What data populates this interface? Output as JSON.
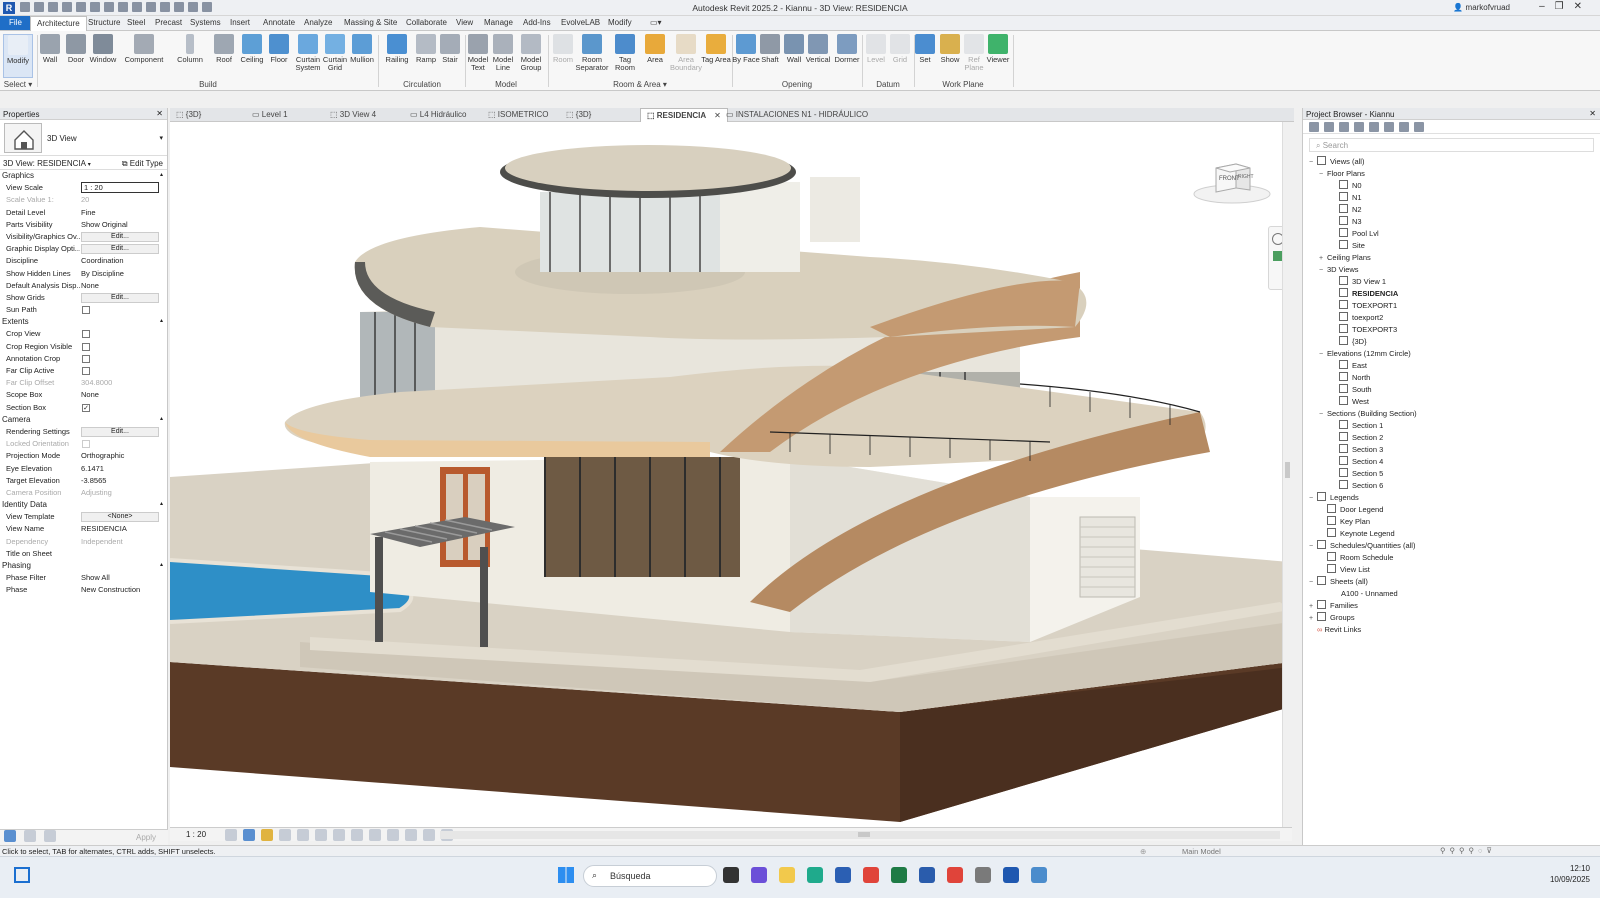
{
  "window": {
    "title": "Autodesk Revit 2025.2 - Kiannu - 3D View: RESIDENCIA",
    "user": "markofvruad"
  },
  "ribbon_tabs": [
    "File",
    "Architecture",
    "Structure",
    "Steel",
    "Precast",
    "Systems",
    "Insert",
    "Annotate",
    "Analyze",
    "Massing & Site",
    "Collaborate",
    "View",
    "Manage",
    "Add-Ins",
    "EvolveLAB",
    "Modify"
  ],
  "ribbon": {
    "select": {
      "modify": "Modify",
      "group": "Select"
    },
    "build": {
      "group": "Build",
      "wall": "Wall",
      "door": "Door",
      "window": "Window",
      "component": "Component",
      "column": "Column",
      "roof": "Roof",
      "ceiling": "Ceiling",
      "floor": "Floor",
      "curtain_system": "Curtain System",
      "curtain_grid": "Curtain Grid",
      "mullion": "Mullion"
    },
    "circulation": {
      "group": "Circulation",
      "railing": "Railing",
      "ramp": "Ramp",
      "stair": "Stair"
    },
    "model": {
      "group": "Model",
      "model_text": "Model Text",
      "model_line": "Model Line",
      "model_group": "Model Group"
    },
    "room_area": {
      "group": "Room & Area",
      "room": "Room",
      "room_separator": "Room Separator",
      "tag_room": "Tag Room",
      "area": "Area",
      "area_boundary": "Area Boundary",
      "tag_area": "Tag Area"
    },
    "opening": {
      "group": "Opening",
      "by_face": "By Face",
      "shaft": "Shaft",
      "wall": "Wall",
      "vertical": "Vertical",
      "dormer": "Dormer"
    },
    "datum": {
      "group": "Datum",
      "level": "Level",
      "grid": "Grid"
    },
    "work_plane": {
      "group": "Work Plane",
      "set": "Set",
      "show": "Show",
      "ref_plane": "Ref Plane",
      "viewer": "Viewer"
    }
  },
  "view_tabs": [
    "{3D}",
    "Level 1",
    "3D View 4",
    "L4 Hidráulico",
    "ISOMETRICO",
    "{3D}",
    "RESIDENCIA",
    "INSTALACIONES N1 - HIDRÁULICO"
  ],
  "properties": {
    "title": "Properties",
    "type_name": "3D View",
    "instance": "3D View: RESIDENCIA",
    "edit_type": "Edit Type",
    "apply": "Apply",
    "graphics": {
      "label": "Graphics",
      "view_scale": {
        "k": "View Scale",
        "v": "1 : 20"
      },
      "scale_value": {
        "k": "Scale Value    1:",
        "v": "20"
      },
      "detail_level": {
        "k": "Detail Level",
        "v": "Fine"
      },
      "parts_visibility": {
        "k": "Parts Visibility",
        "v": "Show Original"
      },
      "vg": {
        "k": "Visibility/Graphics Ov...",
        "v": "Edit..."
      },
      "gdo": {
        "k": "Graphic Display Opti...",
        "v": "Edit..."
      },
      "discipline": {
        "k": "Discipline",
        "v": "Coordination"
      },
      "hidden_lines": {
        "k": "Show Hidden Lines",
        "v": "By Discipline"
      },
      "analysis": {
        "k": "Default Analysis Disp...",
        "v": "None"
      },
      "show_grids": {
        "k": "Show Grids",
        "v": "Edit..."
      },
      "sun_path": {
        "k": "Sun Path"
      }
    },
    "extents": {
      "label": "Extents",
      "crop_view": {
        "k": "Crop View"
      },
      "crop_visible": {
        "k": "Crop Region Visible"
      },
      "annotation_crop": {
        "k": "Annotation Crop"
      },
      "far_clip_active": {
        "k": "Far Clip Active"
      },
      "far_clip_offset": {
        "k": "Far Clip Offset",
        "v": "304.8000"
      },
      "scope_box": {
        "k": "Scope Box",
        "v": "None"
      },
      "section_box": {
        "k": "Section Box",
        "check": "✓"
      }
    },
    "camera": {
      "label": "Camera",
      "rendering": {
        "k": "Rendering Settings",
        "v": "Edit..."
      },
      "locked": {
        "k": "Locked Orientation"
      },
      "projection": {
        "k": "Projection Mode",
        "v": "Orthographic"
      },
      "eye": {
        "k": "Eye Elevation",
        "v": "6.1471"
      },
      "target": {
        "k": "Target Elevation",
        "v": "-3.8565"
      },
      "camera_pos": {
        "k": "Camera Position",
        "v": "Adjusting"
      }
    },
    "identity": {
      "label": "Identity Data",
      "template": {
        "k": "View Template",
        "v": "<None>"
      },
      "view_name": {
        "k": "View Name",
        "v": "RESIDENCIA"
      },
      "dependency": {
        "k": "Dependency",
        "v": "Independent"
      },
      "title_sheet": {
        "k": "Title on Sheet"
      }
    },
    "phasing": {
      "label": "Phasing",
      "phase_filter": {
        "k": "Phase Filter",
        "v": "Show All"
      },
      "phase": {
        "k": "Phase",
        "v": "New Construction"
      }
    }
  },
  "viewcube": {
    "front": "FRONT",
    "right": "RIGHT"
  },
  "view_bar": {
    "scale": "1 : 20"
  },
  "browser": {
    "title": "Project Browser - Kiannu",
    "search": "Search",
    "views_all": "Views (all)",
    "floor_plans": "Floor Plans",
    "fp": [
      "N0",
      "N1",
      "N2",
      "N3",
      "Pool Lvl",
      "Site"
    ],
    "ceiling_plans": "Ceiling Plans",
    "views_3d": "3D Views",
    "v3d": [
      "3D View 1",
      "RESIDENCIA",
      "TOEXPORT1",
      "toexport2",
      "TOEXPORT3",
      "{3D}"
    ],
    "elevations": "Elevations (12mm Circle)",
    "elev": [
      "East",
      "North",
      "South",
      "West"
    ],
    "sections": "Sections (Building Section)",
    "sec": [
      "Section 1",
      "Section 2",
      "Section 3",
      "Section 4",
      "Section 5",
      "Section 6"
    ],
    "legends": "Legends",
    "leg": [
      "Door Legend",
      "Key Plan",
      "Keynote Legend"
    ],
    "schedules": "Schedules/Quantities (all)",
    "sch": [
      "Room Schedule",
      "View List"
    ],
    "sheets": "Sheets (all)",
    "sheet1": "A100 - Unnamed",
    "families": "Families",
    "groups": "Groups",
    "revit_links": "Revit Links"
  },
  "status": {
    "message": "Click to select, TAB for alternates, CTRL adds, SHIFT unselects.",
    "model": "Main Model"
  },
  "taskbar": {
    "search": "Búsqueda",
    "time": "12:10",
    "date": "10/09/2025"
  },
  "colors": {
    "accent": "#1f6ec7",
    "ground": "#5a3a26",
    "floor_slab": "#d9d2c4",
    "wood_band": "#b58a62",
    "pool": "#2e8fc7"
  }
}
